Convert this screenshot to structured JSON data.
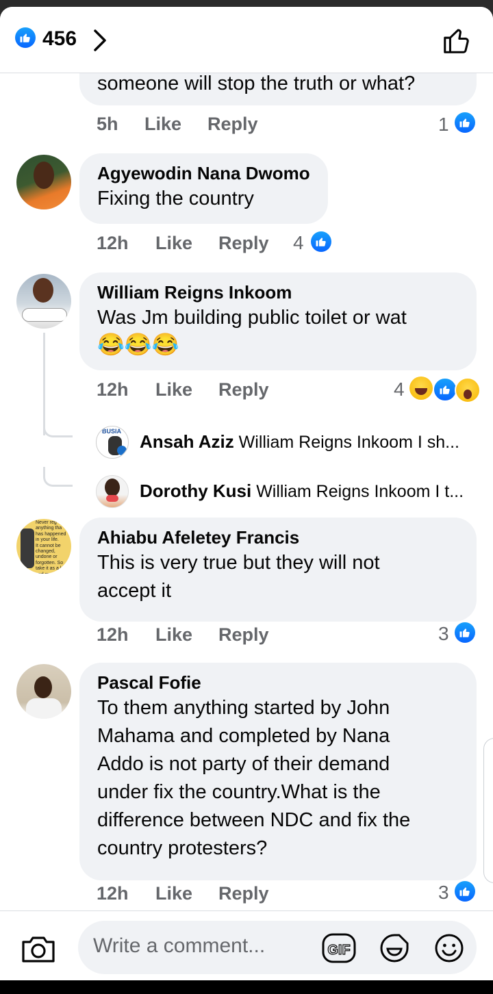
{
  "header": {
    "reaction_count": "456"
  },
  "comments": [
    {
      "text": "someone will stop the truth or what?",
      "time": "5h",
      "like": "Like",
      "reply": "Reply",
      "reactions": "1"
    },
    {
      "author": "Agyewodin Nana Dwomo",
      "text": "Fixing the country",
      "time": "12h",
      "like": "Like",
      "reply": "Reply",
      "reactions": "4"
    },
    {
      "author": "William Reigns Inkoom",
      "text": "Was Jm building public toilet or wat",
      "emoji": "😂😂😂",
      "time": "12h",
      "like": "Like",
      "reply": "Reply",
      "reactions": "4",
      "replies": [
        {
          "author": "Ansah Aziz",
          "text": "William Reigns Inkoom I sh..."
        },
        {
          "author": "Dorothy Kusi",
          "text": "William Reigns Inkoom I t..."
        }
      ]
    },
    {
      "author": "Ahiabu Afeletey Francis",
      "text1": "This is very true but they will not",
      "text2": "accept it",
      "time": "12h",
      "like": "Like",
      "reply": "Reply",
      "reactions": "3"
    },
    {
      "author": "Pascal Fofie",
      "lines": [
        "To them anything started by John",
        "Mahama and completed by Nana",
        "Addo is not party of their demand",
        "under fix the country.What is the",
        "difference between NDC and fix the",
        "country protesters?"
      ],
      "time": "12h",
      "like": "Like",
      "reply": "Reply",
      "reactions": "3"
    }
  ],
  "composer": {
    "placeholder": "Write a comment..."
  },
  "avatar_texts": {
    "ansah": "BUSIA",
    "francis": [
      "Never reg",
      "anything tha",
      "has happened",
      "in your life.",
      "It cannot be",
      "changed,",
      "undone or",
      "forgotten. So",
      "take it as a les",
      "and mo"
    ]
  },
  "colors": {
    "facebook_blue": "#0866ff",
    "bubble": "#f0f2f5",
    "meta_grey": "#65676b"
  }
}
